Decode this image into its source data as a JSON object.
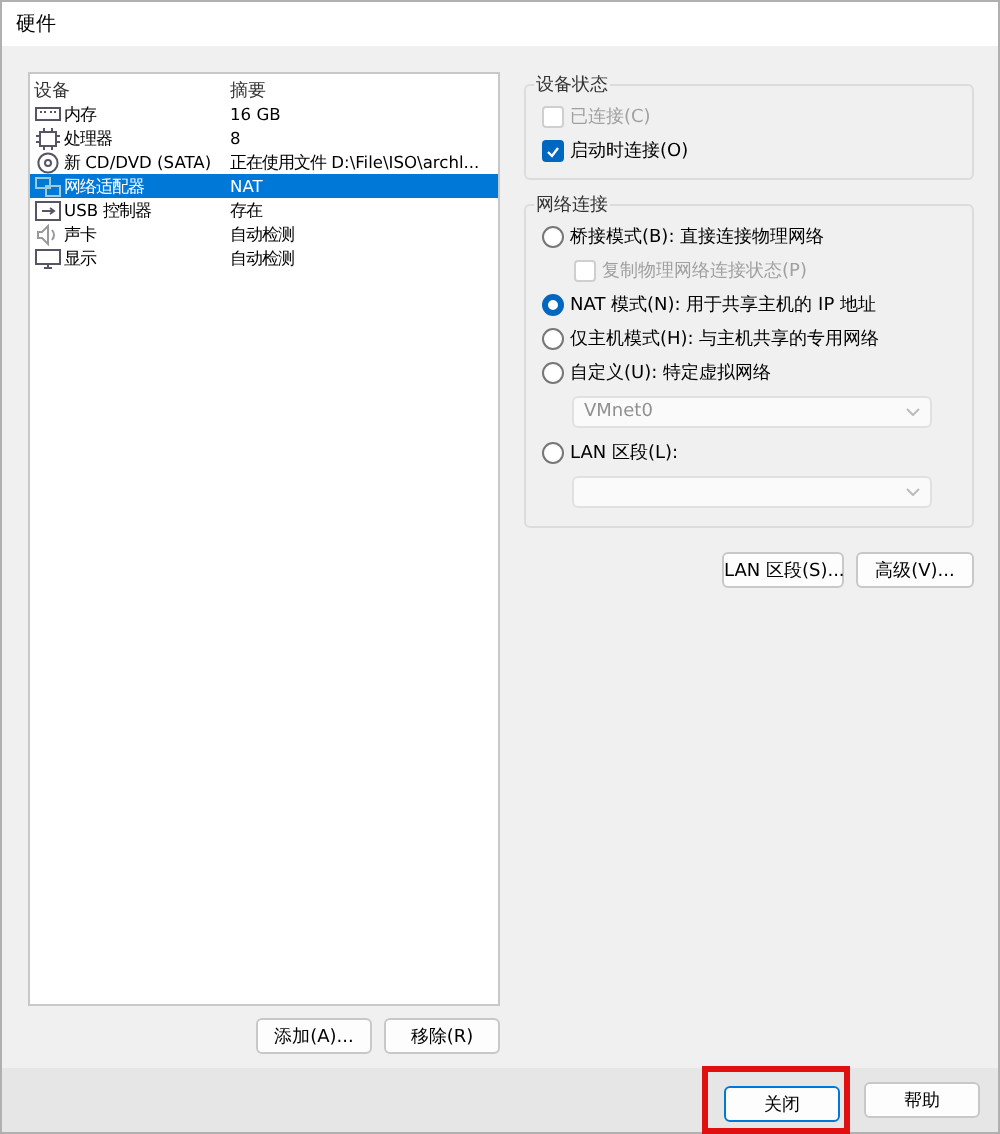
{
  "window": {
    "title": "硬件"
  },
  "device_table": {
    "columns": [
      "设备",
      "摘要"
    ],
    "rows": [
      {
        "device": "内存",
        "summary": "16 GB",
        "selected": false
      },
      {
        "device": "处理器",
        "summary": "8",
        "selected": false
      },
      {
        "device": "新 CD/DVD (SATA)",
        "summary": "正在使用文件 D:\\File\\ISO\\archl...",
        "selected": false
      },
      {
        "device": "网络适配器",
        "summary": "NAT",
        "selected": true
      },
      {
        "device": "USB 控制器",
        "summary": "存在",
        "selected": false
      },
      {
        "device": "声卡",
        "summary": "自动检测",
        "selected": false
      },
      {
        "device": "显示",
        "summary": "自动检测",
        "selected": false
      }
    ]
  },
  "table_buttons": [
    "添加(A)...",
    "移除(R)"
  ],
  "device_status": {
    "title": "设备状态",
    "options": [
      {
        "label": "已连接(C)",
        "checked": false,
        "disabled": true
      },
      {
        "label": "启动时连接(O)",
        "checked": true
      }
    ]
  },
  "network_connection": {
    "title": "网络连接",
    "options": [
      {
        "kind": "radio",
        "label": "桥接模式(B): 直接连接物理网络",
        "selected": false
      },
      {
        "kind": "checkbox",
        "label": "复制物理网络连接状态(P)",
        "checked": false,
        "disabled": true
      },
      {
        "kind": "radio",
        "label": "NAT 模式(N): 用于共享主机的 IP 地址",
        "selected": true
      },
      {
        "kind": "radio",
        "label": "仅主机模式(H): 与主机共享的专用网络",
        "selected": false
      },
      {
        "kind": "radio",
        "label": "自定义(U): 特定虚拟网络",
        "selected": false
      },
      {
        "kind": "dropdown",
        "value": "VMnet0",
        "disabled": true
      },
      {
        "kind": "radio",
        "label": "LAN 区段(L):",
        "selected": false
      },
      {
        "kind": "dropdown",
        "disabled": true
      }
    ]
  },
  "network_buttons": [
    "LAN 区段(S)...",
    "高级(V)..."
  ],
  "footer_buttons": [
    {
      "label": "关闭",
      "highlighted": true,
      "focused": true
    },
    {
      "label": "帮助",
      "highlighted": false,
      "focused": false
    }
  ]
}
